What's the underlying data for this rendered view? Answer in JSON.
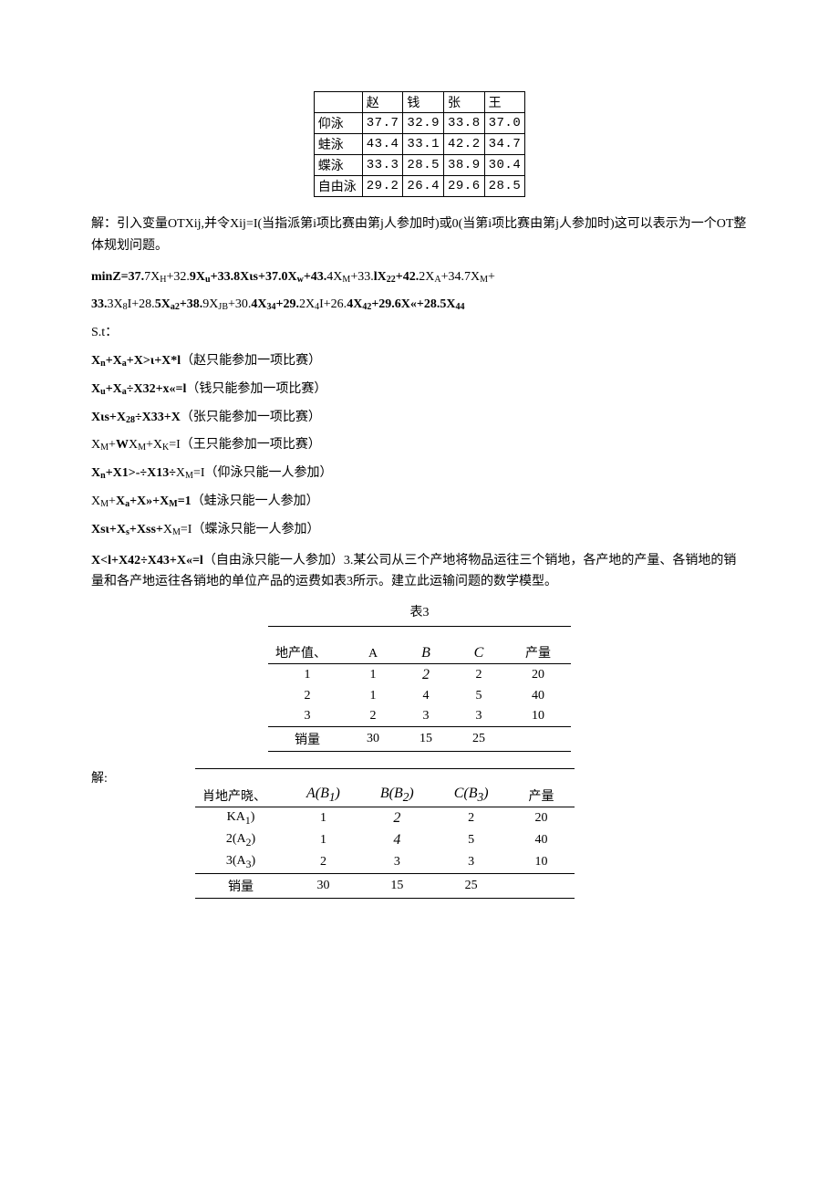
{
  "table1": {
    "headers": [
      "",
      "赵",
      "钱",
      "张",
      "王"
    ],
    "rows": [
      {
        "label": "仰泳",
        "vals": [
          "37.7",
          "32.9",
          "33.8",
          "37.0"
        ]
      },
      {
        "label": "蛙泳",
        "vals": [
          "43.4",
          "33.1",
          "42.2",
          "34.7"
        ]
      },
      {
        "label": "蝶泳",
        "vals": [
          "33.3",
          "28.5",
          "38.9",
          "30.4"
        ]
      },
      {
        "label": "自由泳",
        "vals": [
          "29.2",
          "26.4",
          "29.6",
          "28.5"
        ]
      }
    ]
  },
  "text": {
    "p1": "解：引入变量OTXij,并令Xij=I(当指派第i项比赛由第j人参加时)或0(当第i项比赛由第j人参加时)这可以表示为一个OT整体规划问题。",
    "obj": "minZ=37.",
    "obj_rest": "+33.",
    "f1": "7X",
    "st": "S.t：",
    "c1": "X",
    "c1n": "+X>ι+X*l（赵只能参加一项比赛）",
    "c2": "X",
    "c2n": "+X32+x«=l（钱只能参加一项比赛）",
    "c3": "X",
    "c3n": "+X33+X（张只能参加一项比赛）",
    "c4": "X",
    "c4n": "+X",
    "c4e": "=I（王只能参加一项比赛）",
    "c5": "X",
    "c5n": "+X13÷X",
    "c5e": "=I（仰泳只能一人参加）",
    "c6": "X",
    "c6n": "+X»+X",
    "c6e": "=1（蛙泳只能一人参加）",
    "c7": "X",
    "c7n": "+Xss+X",
    "c7e": "=I（蝶泳只能一人参加）",
    "c8": "X<l+X42÷X43+X«=l（自由泳只能一人参加）",
    "p2": "3.某公司从三个产地将物品运往三个销地，各产地的产量、各销地的销量和各产地运往各销地的单位产品的运费如表3所示。建立此运输问题的数学模型。",
    "t3title": "表3",
    "solution": "解:"
  },
  "table3": {
    "header_first": "地产值、",
    "header_cols": [
      "A",
      "B",
      "C",
      "产量"
    ],
    "rows": [
      {
        "first": "1",
        "vals": [
          "1",
          "2",
          "2",
          "20"
        ]
      },
      {
        "first": "2",
        "vals": [
          "1",
          "4",
          "5",
          "40"
        ]
      },
      {
        "first": "3",
        "vals": [
          "2",
          "3",
          "3",
          "10"
        ]
      }
    ],
    "sales_label": "销量",
    "sales": [
      "30",
      "15",
      "25",
      ""
    ]
  },
  "table4": {
    "header_first": "肖地产晓、",
    "header_cols": [
      "A(B₁)",
      "B(B₂)",
      "C(B₃)",
      "产量"
    ],
    "rows": [
      {
        "first": "KA₁)",
        "vals": [
          "1",
          "2",
          "2",
          "20"
        ]
      },
      {
        "first": "2(A₂)",
        "vals": [
          "1",
          "4",
          "5",
          "40"
        ]
      },
      {
        "first": "3(A₃)",
        "vals": [
          "2",
          "3",
          "3",
          "10"
        ]
      }
    ],
    "sales_label": "销量",
    "sales": [
      "30",
      "15",
      "25",
      ""
    ]
  }
}
